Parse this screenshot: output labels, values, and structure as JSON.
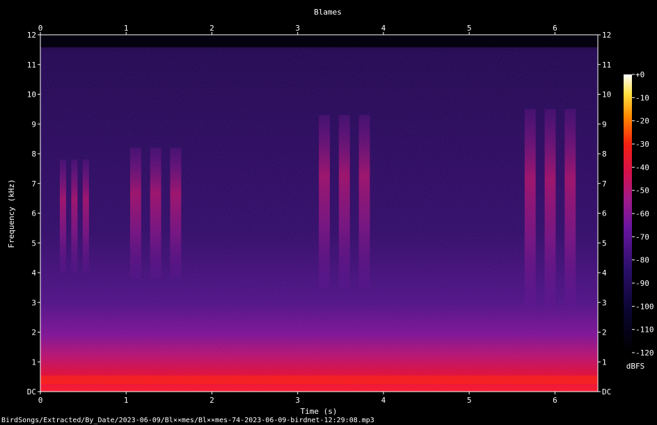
{
  "chart_data": {
    "type": "heatmap",
    "title": "Blames",
    "xlabel": "Time (s)",
    "ylabel": "Frequency (kHz)",
    "x_ticks": [
      "0",
      "1",
      "2",
      "3",
      "4",
      "5",
      "6"
    ],
    "y_ticks": [
      "DC",
      "1",
      "2",
      "3",
      "4",
      "5",
      "6",
      "7",
      "8",
      "9",
      "10",
      "11",
      "12"
    ],
    "xlim": [
      0,
      6.5
    ],
    "ylim": [
      0,
      12
    ],
    "colorbar": {
      "label": "dBFS",
      "ticks": [
        "+0",
        "-10",
        "-20",
        "-30",
        "-40",
        "-50",
        "-60",
        "-70",
        "-80",
        "-90",
        "-100",
        "-110",
        "-120"
      ],
      "range": [
        -120,
        0
      ]
    },
    "colors": {
      "background": "#000000",
      "noise": "#2a0f5c",
      "mid": "#8a1a9a",
      "hot": "#e8103a",
      "peak": "#ffd000"
    },
    "bird_call_bands": [
      {
        "start_s": 0.2,
        "end_s": 0.6,
        "low_khz": 4.0,
        "high_khz": 7.8
      },
      {
        "start_s": 1.0,
        "end_s": 1.7,
        "low_khz": 3.8,
        "high_khz": 8.2
      },
      {
        "start_s": 3.2,
        "end_s": 3.9,
        "low_khz": 3.5,
        "high_khz": 9.3
      },
      {
        "start_s": 5.6,
        "end_s": 6.3,
        "low_khz": 2.8,
        "high_khz": 9.5
      }
    ]
  },
  "footer": {
    "path": "BirdSongs/Extracted/By_Date/2023-06-09/Bl××mes/Bl××mes-74-2023-06-09-birdnet-12:29:08.mp3"
  }
}
